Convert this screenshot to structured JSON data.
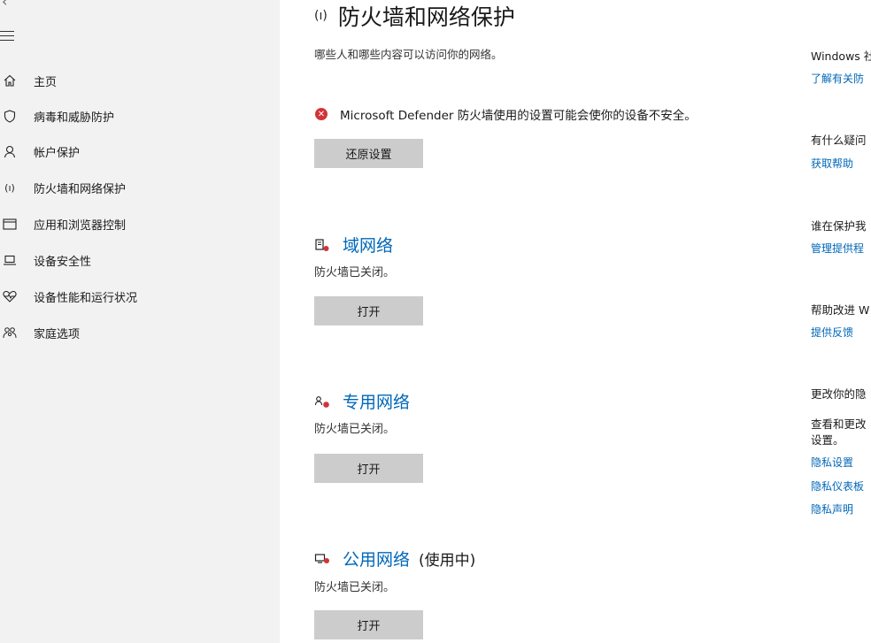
{
  "sidebar": {
    "items": [
      {
        "label": "主页",
        "icon": "home-icon"
      },
      {
        "label": "病毒和威胁防护",
        "icon": "shield-icon"
      },
      {
        "label": "帐户保护",
        "icon": "person-icon"
      },
      {
        "label": "防火墙和网络保护",
        "icon": "wireless-icon"
      },
      {
        "label": "应用和浏览器控制",
        "icon": "app-window-icon"
      },
      {
        "label": "设备安全性",
        "icon": "laptop-icon"
      },
      {
        "label": "设备性能和运行状况",
        "icon": "heart-icon"
      },
      {
        "label": "家庭选项",
        "icon": "family-icon"
      }
    ]
  },
  "main": {
    "title": "防火墙和网络保护",
    "subtitle": "哪些人和哪些内容可以访问你的网络。",
    "warning": "Microsoft Defender 防火墙使用的设置可能会使你的设备不安全。",
    "restore_button": "还原设置",
    "networks": [
      {
        "name": "域网络",
        "status": "防火墙已关闭。",
        "button": "打开",
        "in_use": ""
      },
      {
        "name": "专用网络",
        "status": "防火墙已关闭。",
        "button": "打开",
        "in_use": ""
      },
      {
        "name": "公用网络",
        "status": "防火墙已关闭。",
        "button": "打开",
        "in_use": "(使用中)"
      }
    ]
  },
  "right": {
    "windows_text": "Windows 社",
    "learn_link": "了解有关防",
    "question": "有什么疑问",
    "help_link": "获取帮助",
    "protect": "谁在保护我",
    "manage_link": "管理提供程",
    "improve": "帮助改进 W",
    "feedback_link": "提供反馈",
    "change": "更改你的隐",
    "view_change_1": "查看和更改",
    "view_change_2": "设置。",
    "privacy_settings": "隐私设置",
    "privacy_dashboard": "隐私仪表板",
    "privacy_statement": "隐私声明"
  },
  "colors": {
    "accent": "#0067b8",
    "error": "#d13438",
    "sidebar_bg": "#f2f2f2",
    "button_bg": "#cccccc"
  }
}
